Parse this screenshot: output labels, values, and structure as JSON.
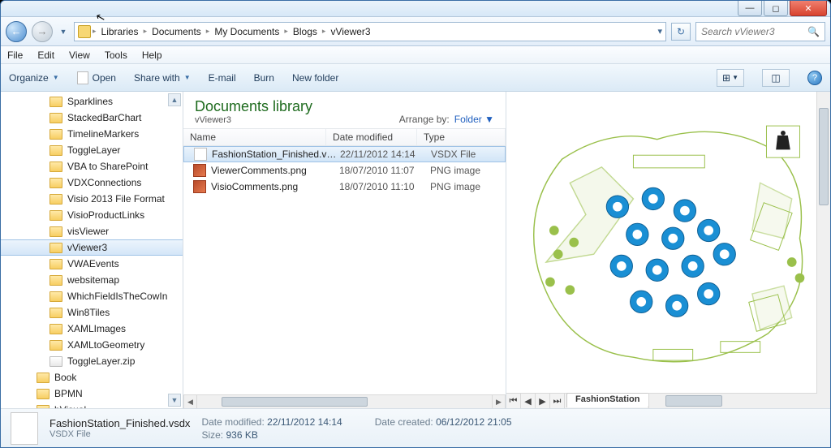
{
  "titlebar": {
    "min": "—",
    "max": "◻",
    "close": "✕"
  },
  "nav": {
    "back": "←",
    "fwd": "→",
    "dropdown": "▼",
    "refresh": "↻"
  },
  "breadcrumbs": [
    "Libraries",
    "Documents",
    "My Documents",
    "Blogs",
    "vViewer3"
  ],
  "search": {
    "placeholder": "Search vViewer3",
    "icon": "🔍"
  },
  "menu": [
    "File",
    "Edit",
    "View",
    "Tools",
    "Help"
  ],
  "cmdbar": {
    "organize": "Organize",
    "open": "Open",
    "share": "Share with",
    "email": "E-mail",
    "burn": "Burn",
    "newfolder": "New folder"
  },
  "tree": [
    {
      "label": "Sparklines",
      "icon": "folder",
      "indent": 0
    },
    {
      "label": "StackedBarChart",
      "icon": "folder",
      "indent": 0
    },
    {
      "label": "TimelineMarkers",
      "icon": "folder",
      "indent": 0
    },
    {
      "label": "ToggleLayer",
      "icon": "folder",
      "indent": 0
    },
    {
      "label": "VBA to SharePoint",
      "icon": "folder",
      "indent": 0
    },
    {
      "label": "VDXConnections",
      "icon": "folder",
      "indent": 0
    },
    {
      "label": "Visio 2013 File Format",
      "icon": "folder",
      "indent": 0
    },
    {
      "label": "VisioProductLinks",
      "icon": "folder",
      "indent": 0
    },
    {
      "label": "visViewer",
      "icon": "folder",
      "indent": 0
    },
    {
      "label": "vViewer3",
      "icon": "folder",
      "indent": 0,
      "selected": true
    },
    {
      "label": "VWAEvents",
      "icon": "folder",
      "indent": 0
    },
    {
      "label": "websitemap",
      "icon": "folder",
      "indent": 0
    },
    {
      "label": "WhichFieldIsTheCowIn",
      "icon": "folder",
      "indent": 0
    },
    {
      "label": "Win8Tiles",
      "icon": "folder",
      "indent": 0
    },
    {
      "label": "XAMLImages",
      "icon": "folder",
      "indent": 0
    },
    {
      "label": "XAMLtoGeometry",
      "icon": "folder",
      "indent": 0
    },
    {
      "label": "ToggleLayer.zip",
      "icon": "zip",
      "indent": 0
    },
    {
      "label": "Book",
      "icon": "folder",
      "indent": 1
    },
    {
      "label": "BPMN",
      "icon": "folder",
      "indent": 1
    },
    {
      "label": "bVisual",
      "icon": "folder",
      "indent": 1
    }
  ],
  "library": {
    "title": "Documents library",
    "subtitle": "vViewer3",
    "arrange_label": "Arrange by:",
    "arrange_value": "Folder"
  },
  "columns": {
    "name": "Name",
    "date": "Date modified",
    "type": "Type"
  },
  "files": [
    {
      "name": "FashionStation_Finished.vsdx",
      "date": "22/11/2012 14:14",
      "type": "VSDX File",
      "icon": "vsdx",
      "selected": true
    },
    {
      "name": "ViewerComments.png",
      "date": "18/07/2010 11:07",
      "type": "PNG image",
      "icon": "png"
    },
    {
      "name": "VisioComments.png",
      "date": "18/07/2010 11:10",
      "type": "PNG image",
      "icon": "png"
    }
  ],
  "preview": {
    "tab": "FashionStation"
  },
  "details": {
    "filename": "FashionStation_Finished.vsdx",
    "filetype": "VSDX File",
    "modified_label": "Date modified:",
    "modified": "22/11/2012 14:14",
    "size_label": "Size:",
    "size": "936 KB",
    "created_label": "Date created:",
    "created": "06/12/2012 21:05"
  }
}
